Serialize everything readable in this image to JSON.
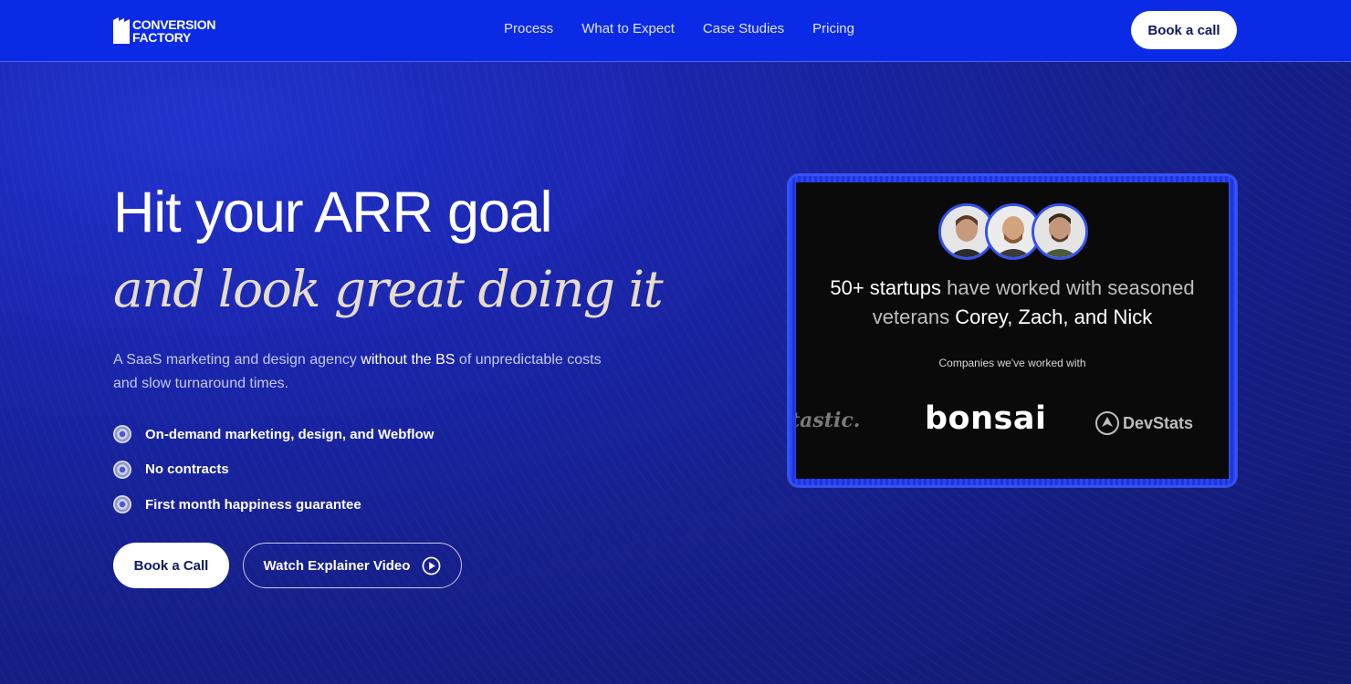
{
  "header": {
    "logo": {
      "line1": "CONVERSION",
      "line2": "FACTORY"
    },
    "nav": [
      "Process",
      "What to Expect",
      "Case Studies",
      "Pricing"
    ],
    "cta_label": "Book a call"
  },
  "hero": {
    "headline": "Hit your ARR goal",
    "subheadline": "and look great doing it",
    "lede": {
      "part1": "A SaaS marketing and design agency ",
      "emphasis": "without the BS",
      "part2": " of unpredictable costs and slow turnaround times."
    },
    "bullets": [
      "On-demand marketing, design, and Webflow",
      "No contracts",
      "First month happiness guarantee"
    ],
    "primary_button": "Book a Call",
    "secondary_button": "Watch Explainer Video",
    "icons": {
      "bullet": "circle-bullet-icon",
      "play": "play-circle-icon"
    }
  },
  "video_card": {
    "title_part1": "50+ startups",
    "title_part2": " have worked with seasoned veterans ",
    "title_part3": "Corey, Zach, and Nick",
    "companies_label": "Companies we've worked with",
    "logos": [
      "tastic.",
      "bonsai",
      "DevStats"
    ],
    "avatars": [
      "avatar-1",
      "avatar-2",
      "avatar-3"
    ]
  },
  "colors": {
    "header_bg": "#0b2ae6",
    "hero_bg": "#141c74",
    "accent": "#3451f0",
    "subheadline": "#e6dcc8",
    "button_text": "#0a1a66"
  }
}
